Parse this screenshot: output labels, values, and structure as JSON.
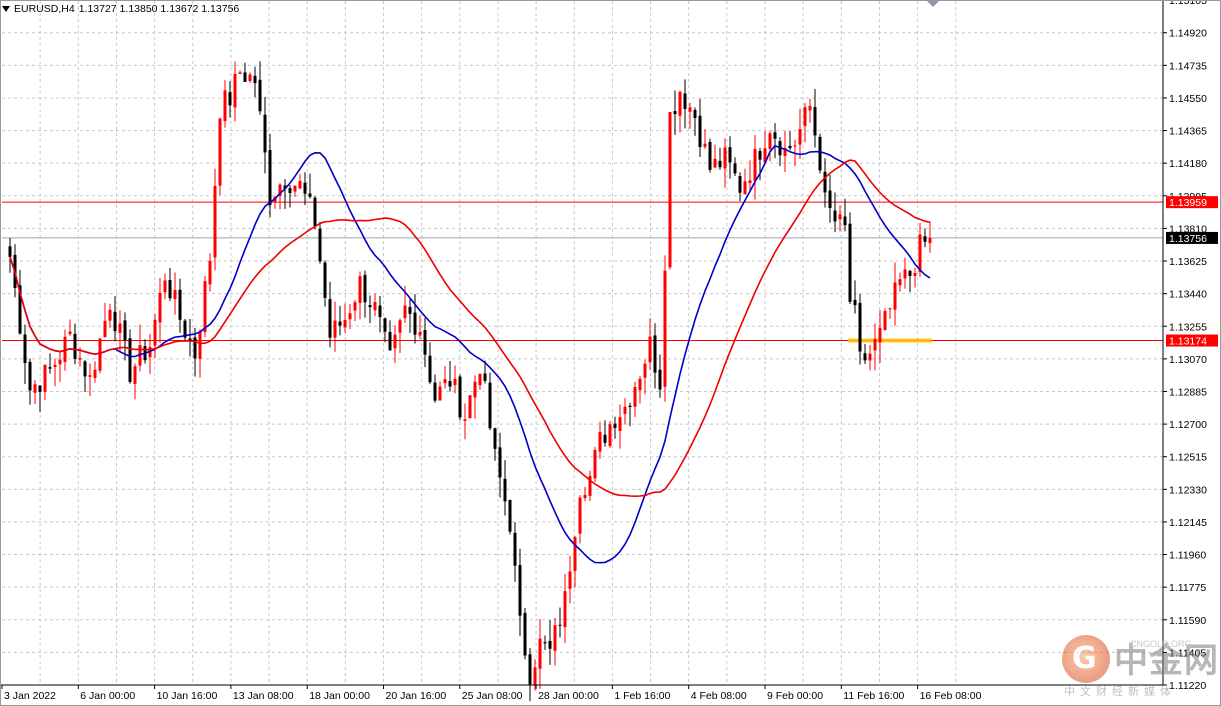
{
  "header": {
    "symbol_tf": "EURUSD,H4",
    "quote": "1.13727 1.13850 1.13672 1.13756"
  },
  "colors": {
    "bull": "#ff0000",
    "bear": "#000000",
    "ma_fast": "#0000c8",
    "ma_slow": "#ee0000",
    "grid": "#c8c8c8",
    "hline_red": "#ff0000",
    "hline_gray": "#9aa4b0",
    "zone": "#ffc000"
  },
  "watermark": {
    "logo_glyph": "G",
    "name": "中金网",
    "url": "CNGOLD.ORG",
    "sub": "中文财经新媒体"
  },
  "chart_data": {
    "type": "candlestick",
    "symbol": "EURUSD",
    "timeframe": "H4",
    "ylim": [
      1.1122,
      1.151
    ],
    "y_ticks": [
      "1.15105",
      "1.14920",
      "1.14735",
      "1.14550",
      "1.14365",
      "1.14180",
      "1.13995",
      "1.13810",
      "1.13625",
      "1.13440",
      "1.13255",
      "1.13070",
      "1.12885",
      "1.12700",
      "1.12515",
      "1.12330",
      "1.12145",
      "1.11960",
      "1.11775",
      "1.11590",
      "1.11405",
      "1.11220"
    ],
    "x_ticks": [
      "3 Jan 2022",
      "6 Jan 00:00",
      "10 Jan 16:00",
      "13 Jan 08:00",
      "18 Jan 00:00",
      "20 Jan 16:00",
      "25 Jan 08:00",
      "28 Jan 00:00",
      "1 Feb 16:00",
      "4 Feb 08:00",
      "9 Feb 00:00",
      "11 Feb 16:00",
      "16 Feb 08:00"
    ],
    "grid": true,
    "price_labels": [
      {
        "value": 1.13959,
        "text": "1.13959",
        "style": "red"
      },
      {
        "value": 1.13756,
        "text": "1.13756",
        "style": "current"
      },
      {
        "value": 1.13174,
        "text": "1.13174",
        "style": "red"
      }
    ],
    "support_zone": {
      "value": 1.13174
    },
    "anchors": [
      [
        0,
        1.1365
      ],
      [
        4,
        1.129
      ],
      [
        8,
        1.13
      ],
      [
        12,
        1.132
      ],
      [
        16,
        1.1295
      ],
      [
        20,
        1.134
      ],
      [
        24,
        1.13
      ],
      [
        28,
        1.1315
      ],
      [
        31,
        1.1355
      ],
      [
        34,
        1.133
      ],
      [
        37,
        1.131
      ],
      [
        40,
        1.1365
      ],
      [
        42,
        1.145
      ],
      [
        44,
        1.1455
      ],
      [
        46,
        1.147
      ],
      [
        49,
        1.1465
      ],
      [
        52,
        1.14
      ],
      [
        55,
        1.141
      ],
      [
        58,
        1.1405
      ],
      [
        61,
        1.1385
      ],
      [
        64,
        1.132
      ],
      [
        67,
        1.133
      ],
      [
        70,
        1.135
      ],
      [
        73,
        1.1335
      ],
      [
        76,
        1.1305
      ],
      [
        79,
        1.1335
      ],
      [
        82,
        1.1325
      ],
      [
        85,
        1.1285
      ],
      [
        88,
        1.1295
      ],
      [
        91,
        1.1275
      ],
      [
        94,
        1.1305
      ],
      [
        97,
        1.125
      ],
      [
        100,
        1.1215
      ],
      [
        102,
        1.1155
      ],
      [
        104,
        1.113
      ],
      [
        106,
        1.1145
      ],
      [
        108,
        1.114
      ],
      [
        111,
        1.117
      ],
      [
        114,
        1.1235
      ],
      [
        116,
        1.124
      ],
      [
        118,
        1.126
      ],
      [
        121,
        1.1275
      ],
      [
        123,
        1.128
      ],
      [
        126,
        1.13
      ],
      [
        128,
        1.1315
      ],
      [
        130,
        1.1295
      ],
      [
        131,
        1.1365
      ],
      [
        132,
        1.1445
      ],
      [
        134,
        1.146
      ],
      [
        137,
        1.1445
      ],
      [
        140,
        1.1415
      ],
      [
        143,
        1.142
      ],
      [
        146,
        1.1405
      ],
      [
        149,
        1.142
      ],
      [
        152,
        1.144
      ],
      [
        155,
        1.1425
      ],
      [
        157,
        1.143
      ],
      [
        160,
        1.145
      ],
      [
        162,
        1.142
      ],
      [
        163,
        1.1395
      ],
      [
        165,
        1.1385
      ],
      [
        167,
        1.138
      ],
      [
        168,
        1.134
      ],
      [
        169,
        1.133
      ],
      [
        170,
        1.1305
      ],
      [
        172,
        1.131
      ],
      [
        174,
        1.132
      ],
      [
        176,
        1.1335
      ],
      [
        178,
        1.135
      ],
      [
        180,
        1.1355
      ],
      [
        182,
        1.137
      ],
      [
        184,
        1.1375
      ]
    ]
  }
}
